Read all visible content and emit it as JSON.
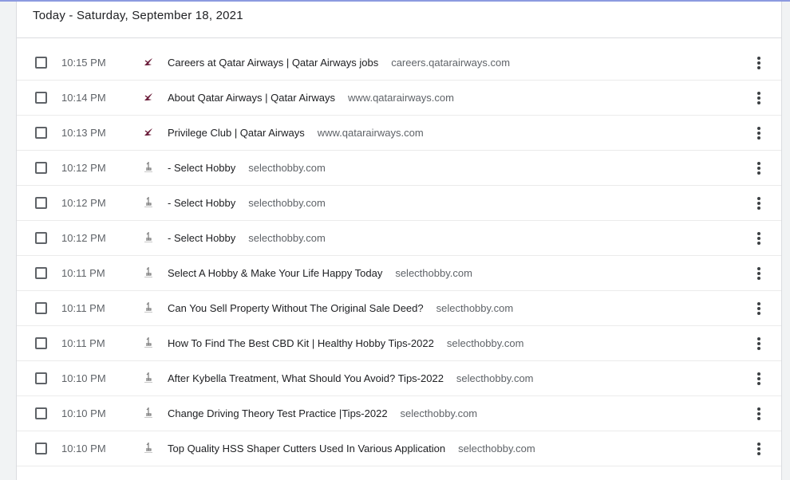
{
  "colors": {
    "accent_line": "#8c9ae0",
    "qatar_icon": "#6b1d3a",
    "hobby_icon": "#7a7a7a"
  },
  "header": {
    "title": "Today - Saturday, September 18, 2021"
  },
  "entries": [
    {
      "time": "10:15 PM",
      "title": "Careers at Qatar Airways | Qatar Airways jobs",
      "domain": "careers.qatarairways.com",
      "icon": "qatar-airways-icon"
    },
    {
      "time": "10:14 PM",
      "title": "About Qatar Airways | Qatar Airways",
      "domain": "www.qatarairways.com",
      "icon": "qatar-airways-icon"
    },
    {
      "time": "10:13 PM",
      "title": "Privilege Club | Qatar Airways",
      "domain": "www.qatarairways.com",
      "icon": "qatar-airways-icon"
    },
    {
      "time": "10:12 PM",
      "title": "- Select Hobby",
      "domain": "selecthobby.com",
      "icon": "select-hobby-icon"
    },
    {
      "time": "10:12 PM",
      "title": "- Select Hobby",
      "domain": "selecthobby.com",
      "icon": "select-hobby-icon"
    },
    {
      "time": "10:12 PM",
      "title": "- Select Hobby",
      "domain": "selecthobby.com",
      "icon": "select-hobby-icon"
    },
    {
      "time": "10:11 PM",
      "title": "Select A Hobby & Make Your Life Happy Today",
      "domain": "selecthobby.com",
      "icon": "select-hobby-icon"
    },
    {
      "time": "10:11 PM",
      "title": "Can You Sell Property Without The Original Sale Deed?",
      "domain": "selecthobby.com",
      "icon": "select-hobby-icon"
    },
    {
      "time": "10:11 PM",
      "title": "How To Find The Best CBD Kit | Healthy Hobby Tips-2022",
      "domain": "selecthobby.com",
      "icon": "select-hobby-icon"
    },
    {
      "time": "10:10 PM",
      "title": "After Kybella Treatment, What Should You Avoid? Tips-2022",
      "domain": "selecthobby.com",
      "icon": "select-hobby-icon"
    },
    {
      "time": "10:10 PM",
      "title": "Change Driving Theory Test Practice |Tips-2022",
      "domain": "selecthobby.com",
      "icon": "select-hobby-icon"
    },
    {
      "time": "10:10 PM",
      "title": "Top Quality HSS Shaper Cutters Used In Various Application",
      "domain": "selecthobby.com",
      "icon": "select-hobby-icon"
    }
  ]
}
